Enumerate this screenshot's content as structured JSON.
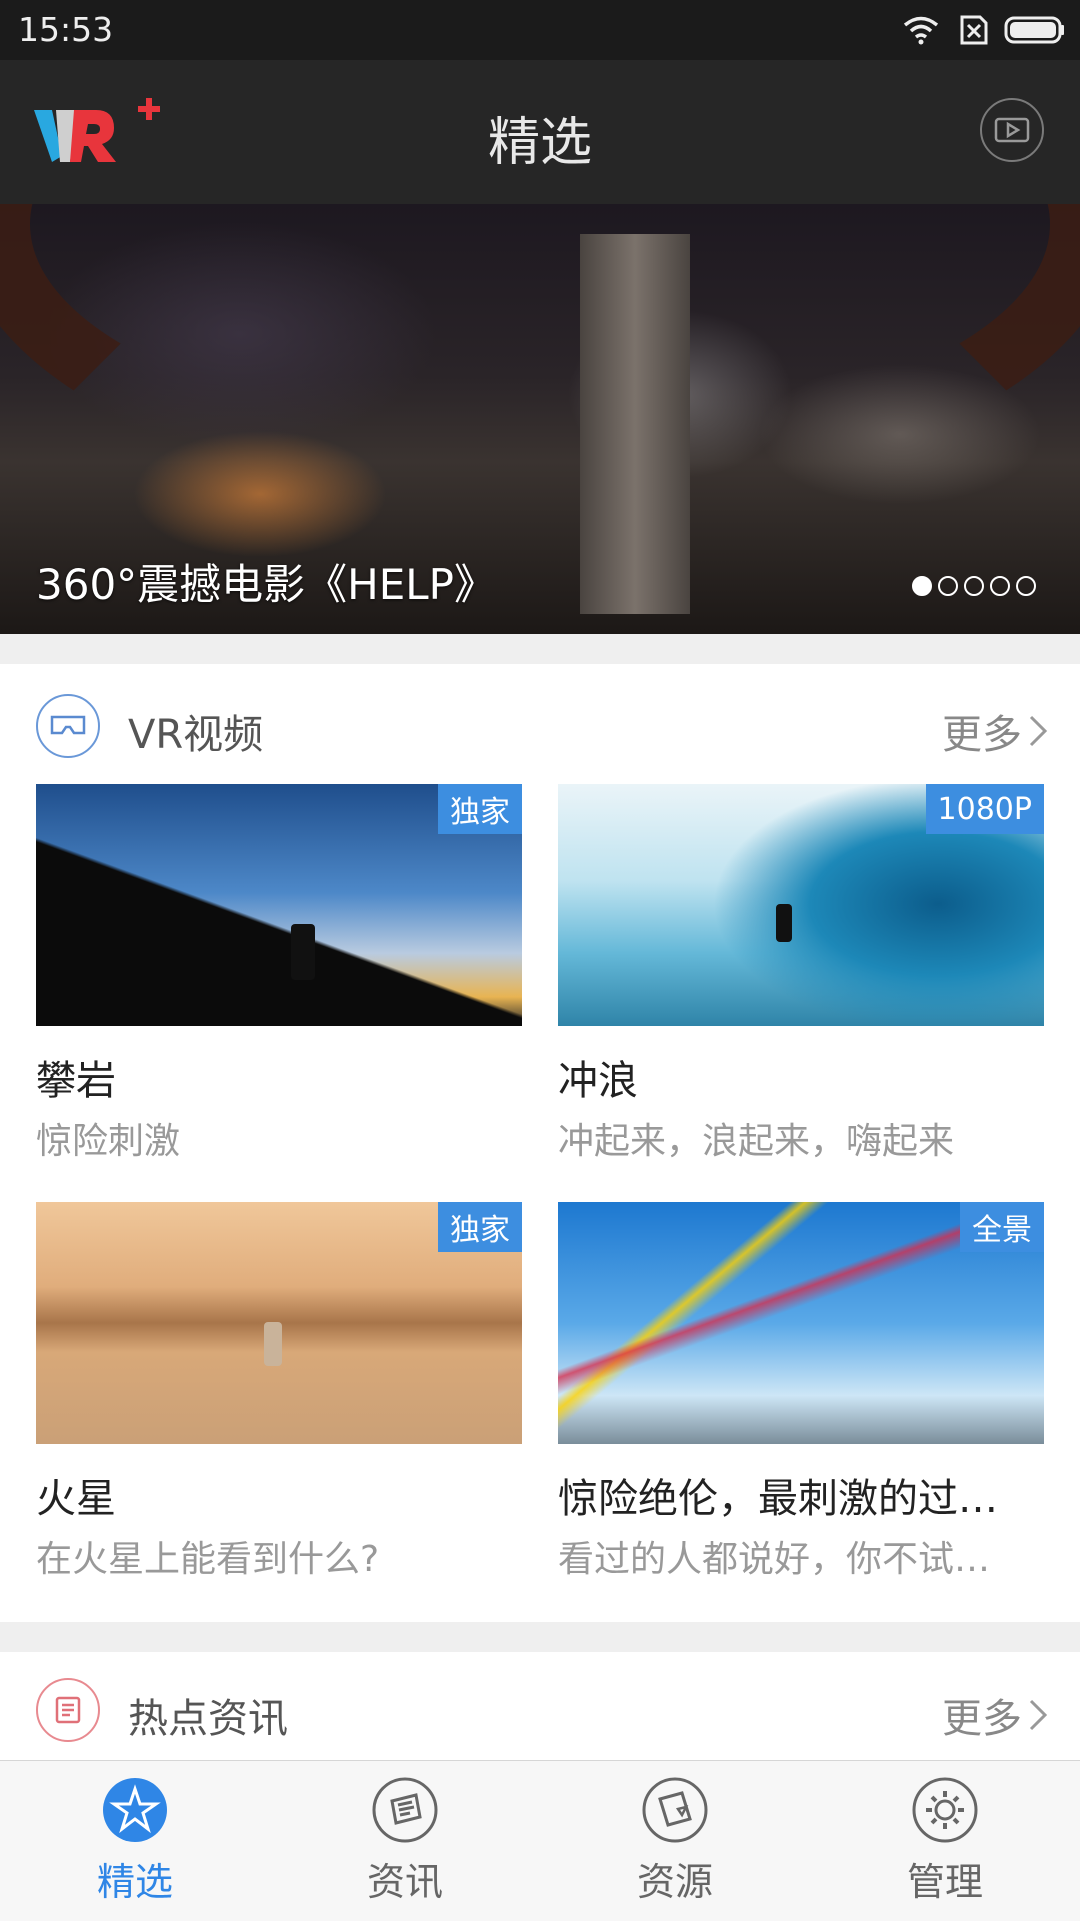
{
  "status_bar": {
    "time": "15:53"
  },
  "app_bar": {
    "title": "精选"
  },
  "banner": {
    "caption": "360°震撼电影《HELP》",
    "slide_count": 5,
    "active_slide": 1
  },
  "vr_section": {
    "title": "VR视频",
    "more": "更多",
    "items": [
      {
        "badge": "独家",
        "title": "攀岩",
        "subtitle": "惊险刺激"
      },
      {
        "badge": "1080P",
        "title": "冲浪",
        "subtitle": "冲起来，浪起来，嗨起来"
      },
      {
        "badge": "独家",
        "title": "火星",
        "subtitle": "在火星上能看到什么?"
      },
      {
        "badge": "全景",
        "title": "惊险绝伦，最刺激的过…",
        "subtitle": "看过的人都说好，你不试…"
      }
    ]
  },
  "news_section": {
    "title": "热点资讯",
    "more": "更多"
  },
  "tab_bar": {
    "tabs": [
      {
        "label": "精选",
        "icon": "star-icon",
        "active": true
      },
      {
        "label": "资讯",
        "icon": "news-icon",
        "active": false
      },
      {
        "label": "资源",
        "icon": "resource-icon",
        "active": false
      },
      {
        "label": "管理",
        "icon": "gear-icon",
        "active": false
      }
    ]
  },
  "colors": {
    "accent": "#2f86e6",
    "badge": "#3d8ee0",
    "appbar": "#262626",
    "logo_blue": "#29a8e0",
    "logo_red": "#e8353c"
  }
}
